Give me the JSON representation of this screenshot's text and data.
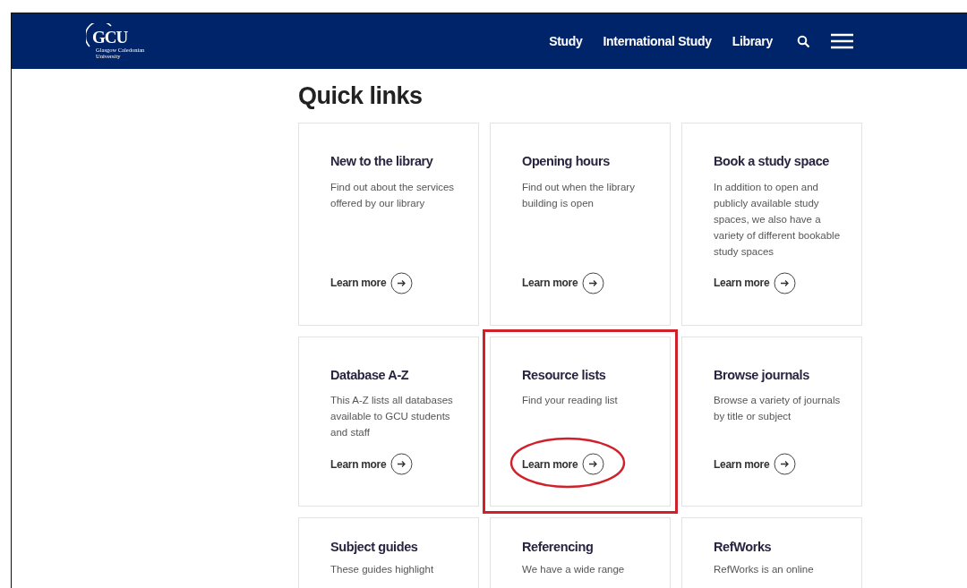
{
  "header": {
    "logo": {
      "initials": "GCU",
      "name_lines": [
        "Glasgow Caledonian",
        "University"
      ]
    },
    "nav_links": [
      "Study",
      "International Study",
      "Library"
    ]
  },
  "heading": "Quick links",
  "cards": [
    {
      "title": "New to the library",
      "description": "Find out about the services offered by our library",
      "link": "Learn more"
    },
    {
      "title": "Opening hours",
      "description": "Find out when the library building is open",
      "link": "Learn more"
    },
    {
      "title": "Book a study space",
      "description": "In addition to open and publicly available study spaces, we also have a variety of different bookable study spaces",
      "link": "Learn more"
    },
    {
      "title": "Database A-Z",
      "description": "This A-Z lists all databases available to GCU students and staff",
      "link": "Learn more"
    },
    {
      "title": "Resource lists",
      "description": "Find your reading list",
      "link": "Learn more",
      "highlighted": true,
      "link_circled": true
    },
    {
      "title": "Browse journals",
      "description": "Browse a variety of journals by title or subject",
      "link": "Learn more"
    },
    {
      "title": "Subject guides",
      "description": "These guides highlight"
    },
    {
      "title": "Referencing",
      "description": "We have a wide range"
    },
    {
      "title": "RefWorks",
      "description": "RefWorks is an online"
    }
  ]
}
